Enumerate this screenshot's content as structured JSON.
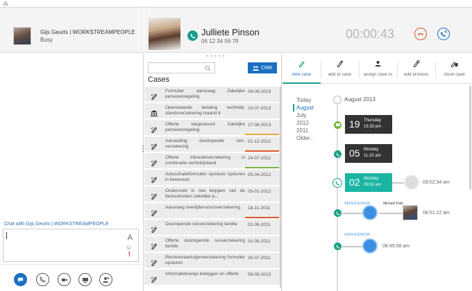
{
  "me": {
    "name": "Gijs Geurts | WORKSTREAMPEOPLE",
    "status": "Busy"
  },
  "chat": {
    "title": "Chat with Gijs Geurts | WORKSTREAMPEOPLE",
    "format_icon": "A"
  },
  "call": {
    "name": "Julliete Pinson",
    "number": "06 12 34 56 78",
    "timer": "00:00:43"
  },
  "cases": {
    "heading": "Cases",
    "crm_label": "CRM",
    "rows": [
      {
        "title": "Formulier aanvraag Zakelijke pensioenregeling",
        "date": "09-09-2013",
        "icon": "pen-icon",
        "bar": ""
      },
      {
        "title": "Openstaande betaling rechtsbij­standsverzekering maand 6",
        "date": "23-07-2013",
        "icon": "bank-icon",
        "bar": ""
      },
      {
        "title": "Offerte toegestuurd Zakelijke pensioenregeling",
        "date": "17-08-2013",
        "icon": "pen-icon",
        "bar": "#e8a33a"
      },
      {
        "title": "Aansluiting doorlopende reis­verzekering",
        "date": "02-12-2012",
        "icon": "pen-icon",
        "bar": "#e0542f"
      },
      {
        "title": "Offerte inboedelverzekering in combinatie rechtsbijstand",
        "date": "24-07-2012",
        "icon": "pen-icon",
        "bar": "#74b83c"
      },
      {
        "title": "Autoschadeformulier opnieuw opsturen in tweevoud",
        "date": "05-04-2012",
        "icon": "pen-icon",
        "bar": ""
      },
      {
        "title": "Onderzoek in niet kloppen van de factuurkosten zakelijke p...",
        "date": "05-01-2012",
        "icon": "pen-icon",
        "bar": ""
      },
      {
        "title": "Aanvraag overlijdensriscover­zekering",
        "date": "18-11-2011",
        "icon": "pen-icon",
        "bar": "#e0542f"
      },
      {
        "title": "Doorlopende reisverzekering familie",
        "date": "02-08-2011",
        "icon": "pen-icon",
        "bar": ""
      },
      {
        "title": "Offerte doorlopende reisverze­kering familie",
        "date": "01-08-2011",
        "icon": "pen-icon",
        "bar": ""
      },
      {
        "title": "Plezierevaartuigenverzekering formulier opsturen",
        "date": "30-07-2011",
        "icon": "pen-icon",
        "bar": ""
      },
      {
        "title": "Informatieboekje beleggen en offerte",
        "date": "09-09-2013",
        "icon": "pen-icon",
        "bar": ""
      }
    ]
  },
  "tabs": [
    {
      "label": "new case",
      "icon": "new-case-icon",
      "active": true
    },
    {
      "label": "add to case",
      "icon": "add-to-case-icon",
      "active": false
    },
    {
      "label": "assign case to",
      "icon": "assign-case-icon",
      "active": false
    },
    {
      "label": "add process",
      "icon": "add-process-icon",
      "active": false
    },
    {
      "label": "close case",
      "icon": "close-case-icon",
      "active": false
    }
  ],
  "years": [
    "Today",
    "August",
    "July",
    "2012",
    "2011",
    "Older.."
  ],
  "timeline": {
    "month": "August 2013",
    "entries": [
      {
        "day": "19",
        "weekday": "Thursday",
        "time": "15:33 pm",
        "style": "dark"
      },
      {
        "day": "05",
        "weekday": "Monday",
        "time": "11:15 am",
        "style": "dark"
      },
      {
        "day": "02",
        "weekday": "Monday",
        "time": "09:02 am",
        "style": "teal"
      }
    ],
    "times": [
      "09:02:34 am",
      "08:51:22 am",
      "08:49:58 am"
    ],
    "servicedesk": "SERVICEDESK",
    "agent": "Michael Park"
  },
  "colors": {
    "accent": "#1b6fc3",
    "teal": "#1a9e8a",
    "hangup": "#e0542f"
  }
}
